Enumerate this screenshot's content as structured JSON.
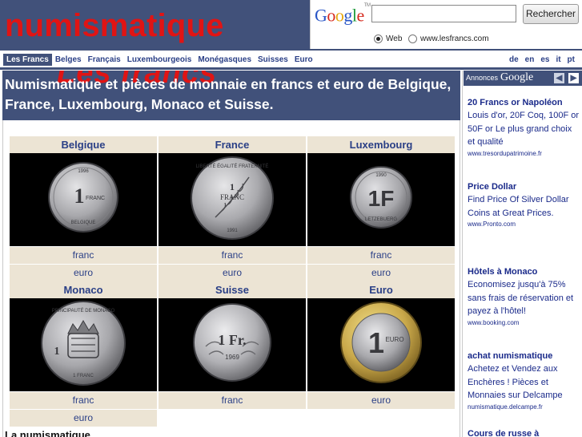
{
  "site": {
    "title": "numismatique"
  },
  "search": {
    "logo_parts": [
      "G",
      "o",
      "o",
      "g",
      "l",
      "e"
    ],
    "logo_tm": "TM",
    "input_value": "",
    "button_label": "Rechercher",
    "radio_web": "Web",
    "radio_site": "www.lesfrancs.com",
    "selected": "Web"
  },
  "nav": {
    "items": [
      "Les Francs",
      "Belges",
      "Français",
      "Luxembourgeois",
      "Monégasques",
      "Suisses",
      "Euro"
    ],
    "active": "Les Francs",
    "languages": [
      "de",
      "en",
      "es",
      "it",
      "pt"
    ]
  },
  "banner": {
    "overlay_title": "Les francs",
    "text": "Numismatique et pièces de monnaie en francs et euro de Belgique, France, Luxembourg, Monaco et Suisse."
  },
  "coins": {
    "row1": [
      {
        "country": "Belgique",
        "links": [
          "franc",
          "euro"
        ],
        "coin": {
          "text": "1 FRANC",
          "rim": "1996 BELGIQUE",
          "color": "#a8a8ac"
        }
      },
      {
        "country": "France",
        "links": [
          "franc",
          "euro"
        ],
        "coin": {
          "text": "1 FRANC",
          "rim": "LIBERTÉ ÉGALITÉ FRATERNITÉ 1991",
          "color": "#a9a9ad"
        }
      },
      {
        "country": "Luxembourg",
        "links": [
          "franc",
          "euro"
        ],
        "coin": {
          "text": "1F",
          "rim": "1990 LETZEBUERG",
          "color": "#a6a6aa"
        }
      }
    ],
    "row2": [
      {
        "country": "Monaco",
        "links": [
          "franc",
          "euro"
        ],
        "coin": {
          "text": "1 FRANC",
          "rim": "PRINCIPAUTÉ DE MONACO",
          "color": "#a7a7ab"
        }
      },
      {
        "country": "Suisse",
        "links": [
          "franc"
        ],
        "coin": {
          "text": "1 Fr.",
          "rim": "HELVETIA 1969",
          "color": "#b0b0b4"
        }
      },
      {
        "country": "Euro",
        "links": [
          "euro"
        ],
        "coin": {
          "text": "1",
          "rim": "EURO",
          "color": "#c9a84a"
        }
      }
    ],
    "footer_partial": "La numismatique"
  },
  "ads": {
    "label": "Annonces",
    "brand": "Google",
    "prev_icon": "chevron-left-icon",
    "next_icon": "chevron-right-icon",
    "items": [
      {
        "title": "20 Francs or Napoléon",
        "body": "Louis d'or, 20F Coq, 100F or 50F or Le plus grand choix et qualité",
        "url": "www.tresordupatrimoine.fr"
      },
      {
        "title": "Price Dollar",
        "body": "Find Price Of Silver Dollar Coins at Great Prices.",
        "url": "www.Pronto.com"
      },
      {
        "title": "Hôtels à Monaco",
        "body": "Economisez jusqu'à 75% sans frais de réservation et payez à l'hôtel!",
        "url": "www.booking.com"
      },
      {
        "title": "achat numismatique",
        "body": "Achetez et Vendez aux Enchères ! Pièces et Monnaies sur Delcampe",
        "url": "numismatique.delcampe.fr"
      },
      {
        "title": "Cours de russe à",
        "body": "",
        "url": ""
      }
    ]
  },
  "colors": {
    "header_bg": "#41517a",
    "title_red": "#e01414",
    "link_blue": "#2a3f86",
    "cell_beige": "#ece4d4"
  }
}
